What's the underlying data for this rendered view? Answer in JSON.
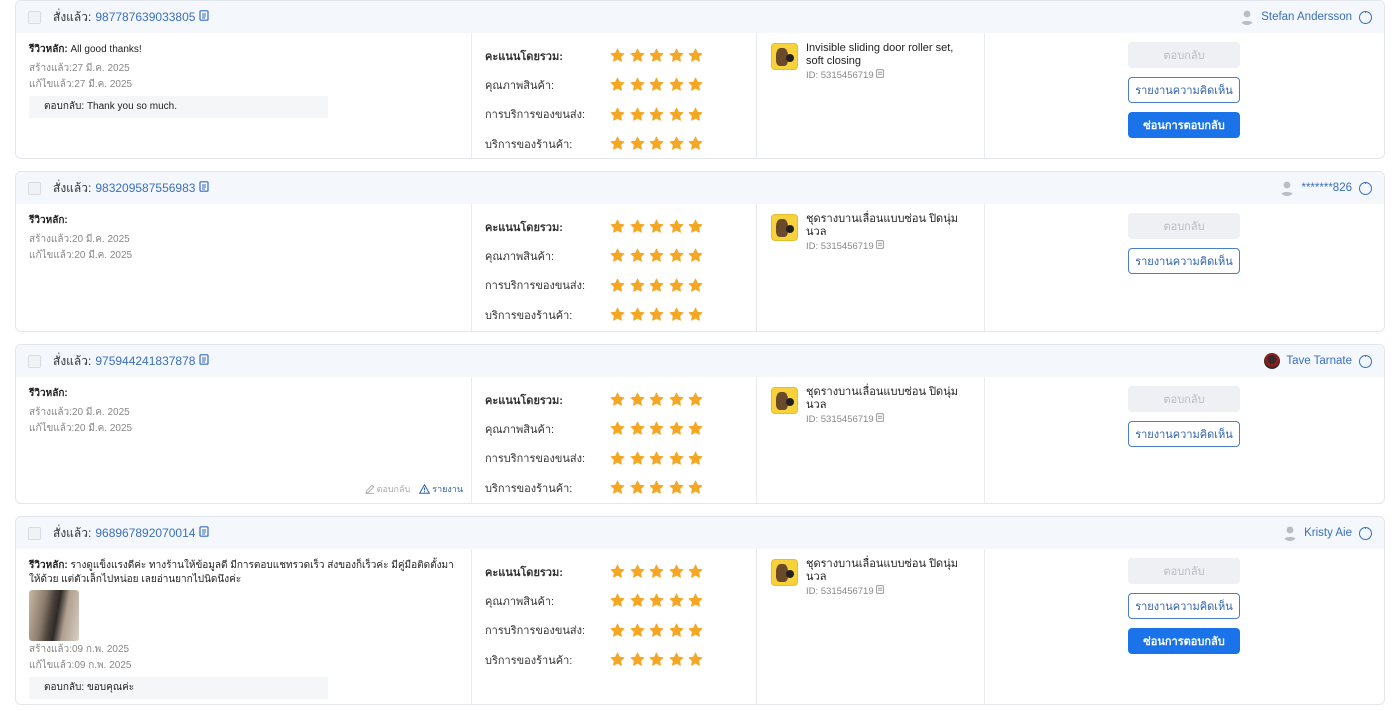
{
  "labels": {
    "ordered": "สั่งแล้ว:",
    "reply_button": "ตอบกลับ",
    "report_button": "รายงานความคิดเห็น",
    "hide_reply_button": "ซ่อนการตอบกลับ",
    "inline_reply": "ตอบกลับ",
    "inline_report": "รายงาน"
  },
  "rating_labels": [
    "คะแนนโดยรวม:",
    "คุณภาพสินค้า:",
    "การบริการของขนส่ง:",
    "บริการของร้านค้า:"
  ],
  "colors": {
    "star": "#f5a623",
    "link": "#3a6fbf",
    "primary": "#1a73e8"
  },
  "reviews": [
    {
      "order_id": "987787639033805",
      "user": "Stefan Andersson",
      "avatar": "default-user-icon",
      "review_label": "รีวิวหลัก:",
      "review_text": "All good thanks!",
      "created": "สร้างแล้ว:27 มี.ค. 2025",
      "edited": "แก้ไขแล้ว:27 มี.ค. 2025",
      "reply_label": "ตอบกลับ:",
      "reply_text": "Thank you so much.",
      "ratings": [
        5,
        5,
        5,
        5
      ],
      "product_name": "Invisible sliding door roller set, soft closing",
      "product_id": "ID: 5315456719"
    },
    {
      "order_id": "983209587556983",
      "user": "*******826",
      "avatar": "default-user-icon",
      "review_label": "รีวิวหลัก:",
      "review_text": "",
      "created": "สร้างแล้ว:20 มี.ค. 2025",
      "edited": "แก้ไขแล้ว:20 มี.ค. 2025",
      "ratings": [
        5,
        5,
        5,
        5
      ],
      "product_name": "ชุดรางบานเลื่อนแบบซ่อน ปิดนุ่มนวล",
      "product_id": "ID: 5315456719"
    },
    {
      "order_id": "975944241837878",
      "user": "Tave Tarnate",
      "avatar": "photo",
      "review_label": "รีวิวหลัก:",
      "review_text": "",
      "created": "สร้างแล้ว:20 มี.ค. 2025",
      "edited": "แก้ไขแล้ว:20 มี.ค. 2025",
      "ratings": [
        5,
        5,
        5,
        5
      ],
      "product_name": "ชุดรางบานเลื่อนแบบซ่อน ปิดนุ่มนวล",
      "product_id": "ID: 5315456719"
    },
    {
      "order_id": "968967892070014",
      "user": "Kristy Aie",
      "avatar": "default-user-icon",
      "review_label": "รีวิวหลัก:",
      "review_text": "รางดูแข็งแรงดีค่ะ ทางร้านให้ข้อมูลดี มีการตอบแชทรวดเร็ว ส่งของก็เร็วค่ะ มีคู่มือติดตั้งมาให้ด้วย แต่ตัวเล็กไปหน่อย เลยอ่านยากไปนิดนึงค่ะ",
      "created": "สร้างแล้ว:09 ก.พ. 2025",
      "edited": "แก้ไขแล้ว:09 ก.พ. 2025",
      "reply_label": "ตอบกลับ:",
      "reply_text": "ขอบคุณค่ะ",
      "ratings": [
        5,
        5,
        5,
        5
      ],
      "product_name": "ชุดรางบานเลื่อนแบบซ่อน ปิดนุ่มนวล",
      "product_id": "ID: 5315456719"
    }
  ]
}
